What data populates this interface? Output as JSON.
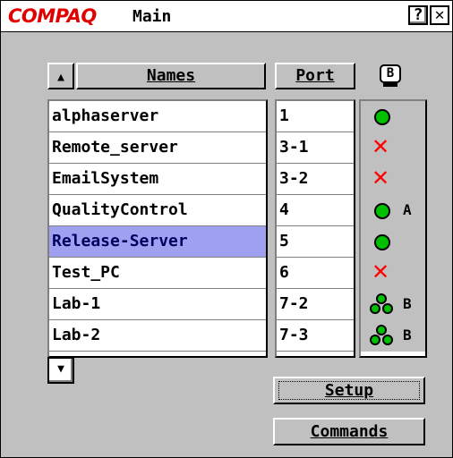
{
  "window": {
    "brand": "COMPAQ",
    "title": "Main",
    "help_label": "?",
    "close_label": "✕"
  },
  "columns": {
    "sort_up": "▲",
    "sort_down": "▼",
    "names": "Names",
    "port": "Port",
    "status_header": "B"
  },
  "rows": [
    {
      "name": "alphaserver",
      "port": "1",
      "status": "online",
      "channel": ""
    },
    {
      "name": "Remote_server",
      "port": "3-1",
      "status": "offline",
      "channel": ""
    },
    {
      "name": "EmailSystem",
      "port": "3-2",
      "status": "offline",
      "channel": ""
    },
    {
      "name": "QualityControl",
      "port": "4",
      "status": "online",
      "channel": "A"
    },
    {
      "name": "Release-Server",
      "port": "5",
      "status": "online",
      "channel": "",
      "selected": true
    },
    {
      "name": "Test_PC",
      "port": "6",
      "status": "offline",
      "channel": ""
    },
    {
      "name": "Lab-1",
      "port": "7-2",
      "status": "group",
      "channel": "B"
    },
    {
      "name": "Lab-2",
      "port": "7-3",
      "status": "group",
      "channel": "B"
    }
  ],
  "buttons": {
    "setup": "Setup",
    "commands": "Commands"
  },
  "colors": {
    "selected_row": "#a0a0f0",
    "online": "#00c000",
    "offline": "#ff0000",
    "brand": "#e00000"
  }
}
